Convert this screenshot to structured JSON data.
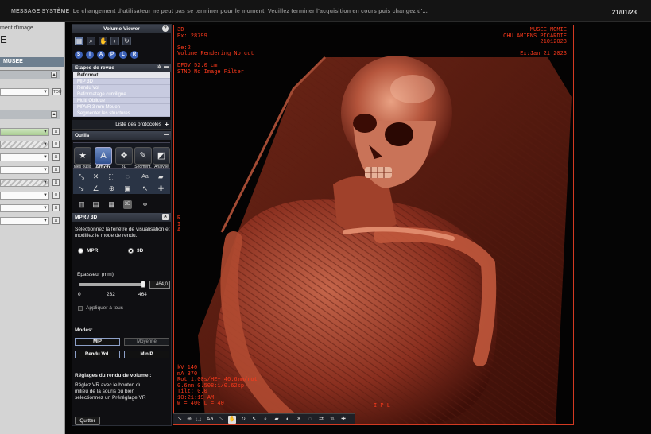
{
  "system_bar": {
    "label": "MESSAGE SYSTÈME",
    "message": "Le changement d'utilisateur ne peut pas se terminer pour le moment.  Veuillez terminer l'acquisition en cours puis changez d'...",
    "date": "21/01/23"
  },
  "left_panel": {
    "title_small": "ment d'image",
    "title_large": "E",
    "musee": "MUSEE",
    "field_button": "TOU",
    "btn_labels": [
      "Ω",
      "Ω",
      "Ω",
      "Ω",
      "Ω",
      "Ω",
      "Ω",
      "Ω"
    ]
  },
  "volume_viewer": {
    "title": "Volume Viewer",
    "help": "?",
    "orientation_buttons": [
      "S",
      "I",
      "A",
      "P",
      "L",
      "R"
    ],
    "steps_header": "Etapes de revue",
    "steps": [
      "Reformat",
      "MIP 3D",
      "Rendu Vol",
      "Reformatage curviligne",
      "Multi Oblique",
      "MPVR 3 mm Mouen",
      "Segmenter les structures"
    ],
    "protocols_label": "Liste des protocoles",
    "tools_header": "Outils",
    "tools": [
      {
        "label": "Mes outils",
        "icon": "star-icon"
      },
      {
        "label": "Affich.",
        "icon": "display-icon"
      },
      {
        "label": "3D",
        "icon": "3d-icon"
      },
      {
        "label": "Segment.",
        "icon": "segment-icon"
      },
      {
        "label": "Analyse",
        "icon": "analysis-icon"
      }
    ],
    "text_tool": "Aa",
    "mpr_header": "MPR / 3D",
    "instruction": "Sélectionnez la fenêtre de visualisation et modifiez le mode de rendu.",
    "radio_mpr": "MPR",
    "radio_3d": "3D",
    "thickness_label": "Epaisseur (mm)",
    "thickness_value": "464,0",
    "thickness_level_fraction": 1.0,
    "ticks": [
      "0",
      "232",
      "464"
    ],
    "apply_all": "Appliquer à tous",
    "modes_label": "Modes:",
    "modes": [
      "MIP",
      "Moyenne",
      "Rendu Vol.",
      "MinIP"
    ],
    "render_settings_label": "Réglages du rendu de volume :",
    "render_settings_text": "Réglez VR avec le bouton du milieu de la souris ou bien sélectionnez un Préréglage VR",
    "quit": "Quitter"
  },
  "viewer": {
    "top_left": "3D\nEx: 28799\n\nSe:2\nVolume Rendering No cut\n\nDFOV 52.0 cm\nSTND No Image Filter",
    "top_right": "MUSEE MOMIE\nCHU AMIENS PICARDIE\n21012023\n\nEx:Jan 21 2023",
    "left_marker": "R\nI\nA",
    "bottom_left": "kV 140\nmA 370\nRot 1.00s/HE+ 46.6mm/rot\n0.6mm 0.508:1/0.62sp\nTilt: 0.0\n10:21:19 AM\nW = 400 L = 40",
    "bottom_right": "I P L",
    "accent_color": "#ff3a1c",
    "border_color": "#d33a22"
  }
}
